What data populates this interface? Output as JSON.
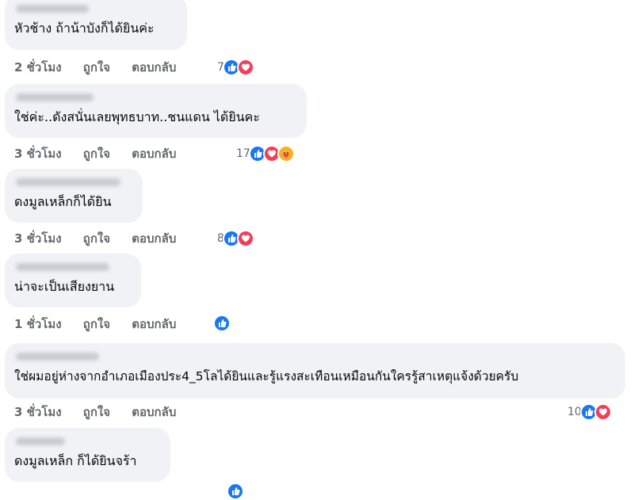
{
  "actions": {
    "like": "ถูกใจ",
    "reply": "ตอบกลับ"
  },
  "comments": [
    {
      "text": "หัวช้าง ถ้าน้าบังก็ได้ยินค่ะ",
      "time": "2 ชั่วโมง",
      "count": "7",
      "reactions": [
        "like-icon",
        "love-icon"
      ]
    },
    {
      "text": "ใช่ค่ะ..ดังสนั่นเลยพุทธบาท..ชนแดน ได้ยินคะ",
      "time": "3 ชั่วโมง",
      "count": "17",
      "reactions": [
        "like-icon",
        "love-icon",
        "care-icon"
      ]
    },
    {
      "text": "ดงมูลเหล็กก็ได้ยิน",
      "time": "3 ชั่วโมง",
      "count": "8",
      "reactions": [
        "like-icon",
        "love-icon"
      ]
    },
    {
      "text": "น่าจะเป็นเสียงยาน",
      "time": "1 ชั่วโมง",
      "count": "",
      "reactions": [
        "like-icon"
      ]
    },
    {
      "text": "ใช่ผมอยู่ห่างจากอำเภอเมืองประ4_5โลได้ยินและรู้แรงสะเทือนเหมือนกันใครรู้สาเหตุแจ้งด้วยครับ",
      "time": "3 ชั่วโมง",
      "count": "10",
      "reactions": [
        "like-icon",
        "love-icon"
      ]
    },
    {
      "text": "ดงมูลเหล็ก ก็ได้ยินจร้า",
      "time": "",
      "count": "",
      "reactions": []
    }
  ]
}
